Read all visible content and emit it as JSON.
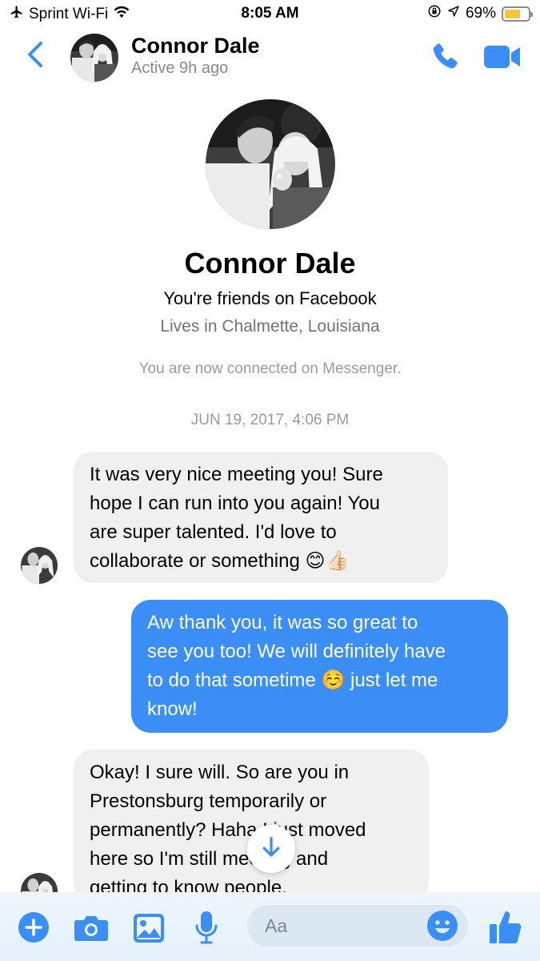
{
  "status_bar": {
    "carrier": "Sprint Wi-Fi",
    "time": "8:05 AM",
    "battery": "69%",
    "battery_level": 0.69,
    "icons": [
      "airplane-icon",
      "wifi-icon",
      "orientation-lock-icon",
      "location-icon",
      "battery-icon"
    ]
  },
  "header": {
    "name": "Connor Dale",
    "status": "Active 9h ago",
    "icons": [
      "back-chevron-icon",
      "phone-icon",
      "video-camera-icon"
    ]
  },
  "profile": {
    "name": "Connor Dale",
    "friends_text": "You're friends on Facebook",
    "location_text": "Lives in Chalmette, Louisiana",
    "connected_text": "You are now connected on Messenger."
  },
  "conversation": {
    "timestamp": "JUN 19, 2017, 4:06 PM",
    "messages": [
      {
        "sender": "them",
        "text": "It was very nice meeting you! Sure\nhope I can run into you again! You\nare super talented. I'd love to\ncollaborate or something 😊👍🏻"
      },
      {
        "sender": "me",
        "text": "Aw thank you, it was so great to\nsee you too! We will definitely have\nto do that sometime ☺️ just let me\nknow!"
      },
      {
        "sender": "them",
        "text": "Okay! I sure will. So are you in\nPrestonsburg temporarily or\npermanently? Haha I just moved\nhere so I'm still meeting and\ngetting to know people."
      }
    ]
  },
  "composer": {
    "placeholder": "Aa",
    "icons": [
      "plus-icon",
      "camera-icon",
      "image-icon",
      "microphone-icon",
      "emoji-icon",
      "thumbs-up-icon"
    ]
  },
  "colors": {
    "accent": "#3a8ef6",
    "incoming_bubble": "#f0f0f0",
    "outgoing_bubble": "#3a8ef6",
    "battery_fill": "#f5c53a"
  }
}
